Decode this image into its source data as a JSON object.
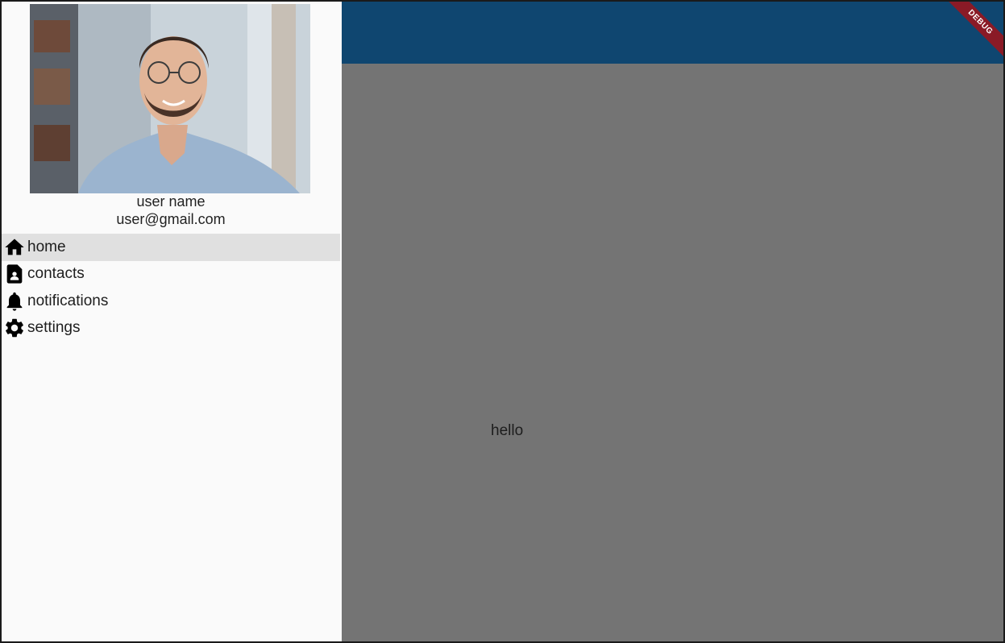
{
  "main": {
    "body_text": "hello"
  },
  "debug_banner": "DEBUG",
  "drawer": {
    "user_name": "user name",
    "user_email": "user@gmail.com",
    "items": [
      {
        "label": "home",
        "icon": "home-icon",
        "selected": true
      },
      {
        "label": "contacts",
        "icon": "contact-page-icon",
        "selected": false
      },
      {
        "label": "notifications",
        "icon": "bell-icon",
        "selected": false
      },
      {
        "label": "settings",
        "icon": "gear-icon",
        "selected": false
      }
    ]
  },
  "colors": {
    "appbar": "#0f4670",
    "scrim_body": "#747474",
    "drawer_bg": "#fafafa",
    "selected_item": "#e0e0e0",
    "debug_ribbon": "#8a1a26"
  }
}
